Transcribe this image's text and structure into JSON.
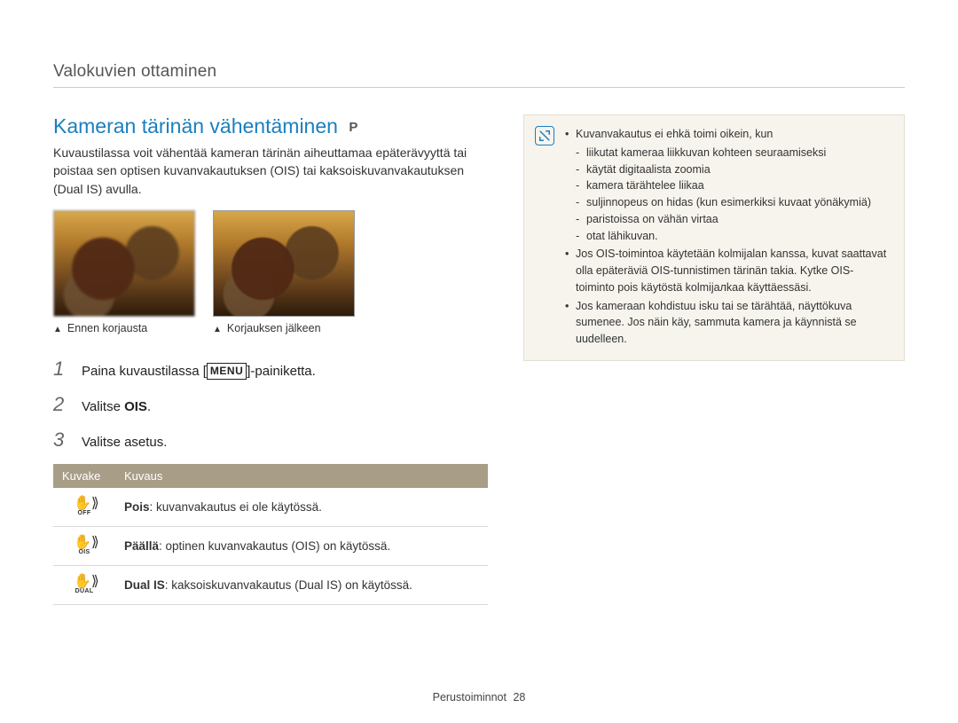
{
  "header": {
    "section": "Valokuvien ottaminen"
  },
  "title": "Kameran tärinän vähentäminen",
  "mode_tag": "P",
  "intro": "Kuvaustilassa voit vähentää kameran tärinän aiheuttamaa epäterävyyttä tai poistaa sen optisen kuvanvakautuksen (OIS) tai kaksoiskuvanvakautuksen (Dual IS) avulla.",
  "photos": {
    "before_caption": "Ennen korjausta",
    "after_caption": "Korjauksen jälkeen"
  },
  "steps": [
    {
      "prefix": "Paina kuvaustilassa [",
      "button": "MENU",
      "suffix": "]-painiketta."
    },
    {
      "text_before": "Valitse ",
      "bold": "OIS",
      "text_after": "."
    },
    {
      "text": "Valitse asetus."
    }
  ],
  "table": {
    "head_icon": "Kuvake",
    "head_desc": "Kuvaus",
    "rows": [
      {
        "icon_sub": "OFF",
        "bold": "Pois",
        "rest": ": kuvanvakautus ei ole käytössä."
      },
      {
        "icon_sub": "OIS",
        "bold": "Päällä",
        "rest": ": optinen kuvanvakautus (OIS) on käytössä."
      },
      {
        "icon_sub": "DUAL",
        "bold": "Dual IS",
        "rest": ": kaksoiskuvanvakautus (Dual IS) on käytössä."
      }
    ]
  },
  "note": {
    "bullets": [
      {
        "text": "Kuvanvakautus ei ehkä toimi oikein, kun",
        "sub": [
          "liikutat kameraa liikkuvan kohteen seuraamiseksi",
          "käytät digitaalista zoomia",
          "kamera tärähtelee liikaa",
          "suljinnopeus on hidas (kun esimerkiksi kuvaat yönäkymiä)",
          "paristoissa on vähän virtaa",
          "otat lähikuvan."
        ]
      },
      {
        "text": "Jos OIS-toimintoa käytetään kolmijalan kanssa, kuvat saattavat olla epäteräviä OIS-tunnistimen tärinän takia. Kytke OIS-toiminto pois käytöstä kolmijалkaa käyttäessäsi."
      },
      {
        "text": "Jos kameraan kohdistuu isku tai se tärähtää, näyttökuva sumenee. Jos näin käy, sammuta kamera ja käynnistä se uudelleen."
      }
    ]
  },
  "footer": {
    "label": "Perustoiminnot",
    "page": "28"
  }
}
